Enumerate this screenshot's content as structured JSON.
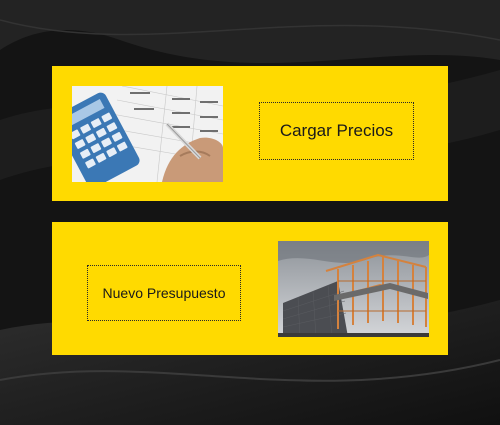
{
  "actions": {
    "load_prices": {
      "label": "Cargar Precios",
      "image": "calculator-spreadsheet-photo"
    },
    "new_budget": {
      "label": "Nuevo Presupuesto",
      "image": "building-construction-photo"
    }
  },
  "colors": {
    "background": "#151515",
    "card": "#FFDA00",
    "text": "#1a1a1a"
  }
}
